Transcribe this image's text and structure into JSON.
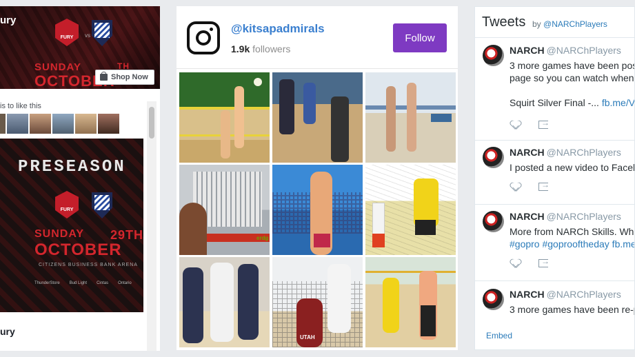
{
  "facebook": {
    "page_name_top": "ury",
    "event_day": "SUNDAY",
    "event_month_top": "OCTOBER",
    "event_date_top": "TH",
    "shop_now_label": "Shop Now",
    "likes_text": "is to like this",
    "post_headline": "PRESEASON",
    "post_day": "SUNDAY",
    "post_month": "OCTOBER",
    "post_date": "29TH",
    "post_arena": "CITIZENS BUSINESS BANK ARENA",
    "post_sponsors": [
      "ThunderStore",
      "Bud Light",
      "Cintas",
      "Ontario"
    ],
    "fury_logo_text": "FURY",
    "vs_text": "vs",
    "page_name_bottom": "ury"
  },
  "instagram": {
    "handle": "@kitsapadmirals",
    "followers_count": "1.9k",
    "followers_label": "followers",
    "follow_label": "Follow",
    "photos": [
      {
        "name": "photo-1"
      },
      {
        "name": "photo-2"
      },
      {
        "name": "photo-3"
      },
      {
        "name": "photo-4",
        "caption": "erdg"
      },
      {
        "name": "photo-5"
      },
      {
        "name": "photo-6"
      },
      {
        "name": "photo-7"
      },
      {
        "name": "photo-8",
        "caption": "UTAH"
      },
      {
        "name": "photo-9"
      }
    ],
    "colors": {
      "follow_button": "#7e3ac2",
      "handle": "#3a7fcf"
    }
  },
  "twitter": {
    "title": "Tweets",
    "by_label": "by",
    "by_handle": "@NARChPlayers",
    "tweets": [
      {
        "name": "NARCH",
        "handle": "@NARChPlayers",
        "text": "3 more games have been pos\npage so you can watch whene\n\nSquirt Silver Final -... ",
        "link": "fb.me/V"
      },
      {
        "name": "NARCH",
        "handle": "@NARChPlayers",
        "text": "I posted a new video to Faceb",
        "link": ""
      },
      {
        "name": "NARCH",
        "handle": "@NARChPlayers",
        "text": "More from NARCh Skills.  Wh\n",
        "link": "#gopro #goprooftheday fb.me"
      },
      {
        "name": "NARCH",
        "handle": "@NARChPlayers",
        "text": "3 more games have been re-p",
        "link": ""
      }
    ],
    "embed_label": "Embed"
  }
}
